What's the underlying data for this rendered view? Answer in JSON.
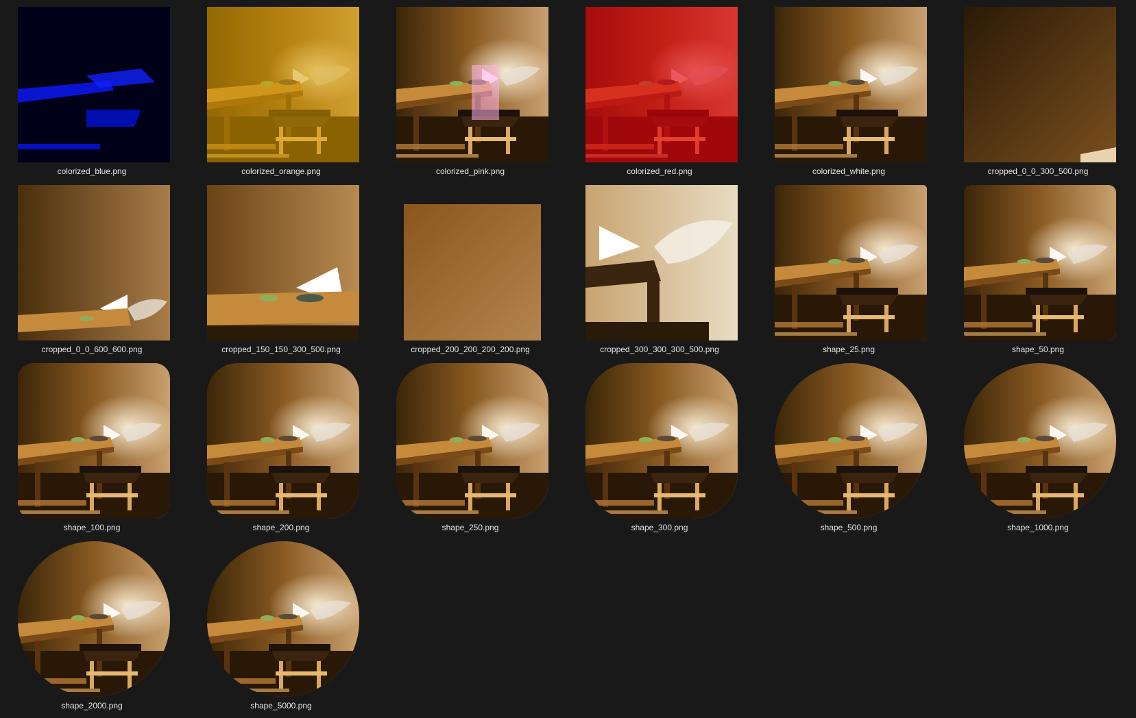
{
  "window": {
    "background": "#191919"
  },
  "files": [
    {
      "name": "colorized_blue.png",
      "variant": "tint",
      "tint": "#1020ff"
    },
    {
      "name": "colorized_orange.png",
      "variant": "tint",
      "tint": "#ffb000"
    },
    {
      "name": "colorized_pink.png",
      "variant": "tint",
      "tint": "#ffc8ff"
    },
    {
      "name": "colorized_red.png",
      "variant": "tint",
      "tint": "#ff0010"
    },
    {
      "name": "colorized_white.png",
      "variant": "tint",
      "tint": "#ffffff"
    },
    {
      "name": "cropped_0_0_300_500.png",
      "variant": "crop",
      "crop": "wall-dark"
    },
    {
      "name": "cropped_0_0_600_600.png",
      "variant": "crop",
      "crop": "wall-table"
    },
    {
      "name": "cropped_150_150_300_500.png",
      "variant": "crop",
      "crop": "table-close"
    },
    {
      "name": "cropped_200_200_200_200.png",
      "variant": "crop",
      "crop": "wall-texture"
    },
    {
      "name": "cropped_300_300_300_500.png",
      "variant": "crop",
      "crop": "light-corner"
    },
    {
      "name": "shape_25.png",
      "variant": "shape",
      "rounding": 25
    },
    {
      "name": "shape_50.png",
      "variant": "shape",
      "rounding": 50
    },
    {
      "name": "shape_100.png",
      "variant": "shape",
      "rounding": 100
    },
    {
      "name": "shape_200.png",
      "variant": "shape",
      "rounding": 200
    },
    {
      "name": "shape_250.png",
      "variant": "shape",
      "rounding": 250
    },
    {
      "name": "shape_300.png",
      "variant": "shape",
      "rounding": 300
    },
    {
      "name": "shape_500.png",
      "variant": "shape",
      "rounding": 500
    },
    {
      "name": "shape_1000.png",
      "variant": "shape",
      "rounding": 1000
    },
    {
      "name": "shape_2000.png",
      "variant": "shape",
      "rounding": 2000
    },
    {
      "name": "shape_5000.png",
      "variant": "shape",
      "rounding": 5000
    }
  ]
}
